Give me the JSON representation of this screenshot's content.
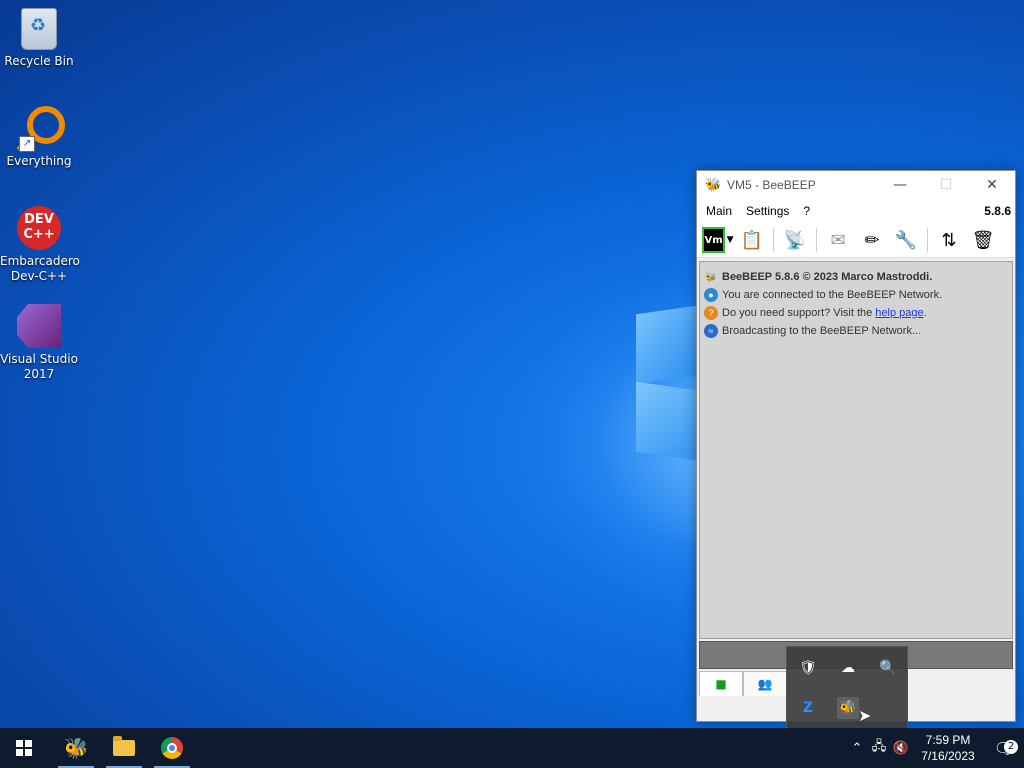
{
  "desktop": {
    "icons": [
      {
        "label": "Recycle Bin"
      },
      {
        "label": "Everything"
      },
      {
        "label": "Embarcadero Dev-C++",
        "badge_text": "DEV C++"
      },
      {
        "label": "Visual Studio 2017"
      }
    ]
  },
  "window": {
    "title": "VM5 - BeeBEEP",
    "minimize": "—",
    "maximize": "☐",
    "close": "✕",
    "menu": [
      "Main",
      "Settings",
      "?"
    ],
    "version": "5.8.6",
    "vm_label": "Vm",
    "chat_lines": [
      {
        "bold": "BeeBEEP 5.8.6 © 2023 Marco Mastroddi."
      },
      {
        "text": "You are connected to the BeeBEEP Network."
      },
      {
        "text_before": "Do you need support? Visit the ",
        "link": "help page",
        "text_after": "."
      },
      {
        "text": "Broadcasting to the BeeBEEP Network..."
      }
    ]
  },
  "taskbar": {
    "clock_time": "7:59 PM",
    "clock_date": "7/16/2023",
    "notification_count": "2"
  },
  "tray_popup": {
    "zoom_label": "Z"
  },
  "colors": {
    "accent_blue": "#0a63d4",
    "taskbar": "#0e1b2e",
    "link": "#1a3cd8"
  }
}
